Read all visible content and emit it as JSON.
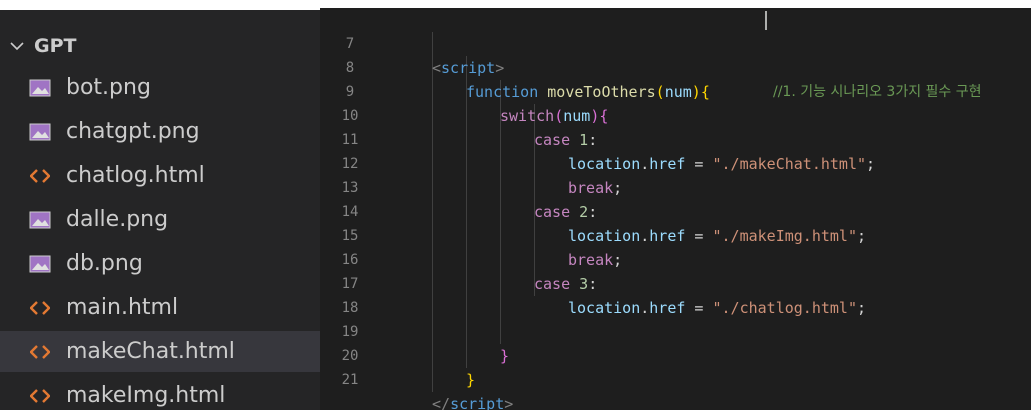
{
  "explorer": {
    "folder_name": "GPT",
    "files": [
      {
        "name": "bot.png",
        "type": "image"
      },
      {
        "name": "chatgpt.png",
        "type": "image"
      },
      {
        "name": "chatlog.html",
        "type": "html"
      },
      {
        "name": "dalle.png",
        "type": "image"
      },
      {
        "name": "db.png",
        "type": "image"
      },
      {
        "name": "main.html",
        "type": "html"
      },
      {
        "name": "makeChat.html",
        "type": "html",
        "selected": true
      },
      {
        "name": "makeImg.html",
        "type": "html"
      }
    ]
  },
  "editor": {
    "lines": [
      {
        "num": "7",
        "tag_open": "<",
        "tag_name": "script",
        "tag_close": ">",
        "comment": "//1. 기능 시나리오 3가지 필수 구현"
      },
      {
        "num": "8",
        "kw": "function",
        "fn": "moveToOthers",
        "p1": "(",
        "param": "num",
        "p2": ")",
        "brace": "{"
      },
      {
        "num": "9",
        "kw": "switch",
        "p1": "(",
        "param": "num",
        "p2": ")",
        "brace": "{"
      },
      {
        "num": "10",
        "kw": "case",
        "val": "1",
        "colon": ":"
      },
      {
        "num": "11",
        "obj": "location",
        "dot": ".",
        "prop": "href",
        "eq": " = ",
        "str": "\"./makeChat.html\"",
        "semi": ";"
      },
      {
        "num": "12",
        "kw": "break",
        "semi": ";"
      },
      {
        "num": "13",
        "kw": "case",
        "val": "2",
        "colon": ":"
      },
      {
        "num": "14",
        "obj": "location",
        "dot": ".",
        "prop": "href",
        "eq": " = ",
        "str": "\"./makeImg.html\"",
        "semi": ";"
      },
      {
        "num": "15",
        "kw": "break",
        "semi": ";"
      },
      {
        "num": "16",
        "kw": "case",
        "val": "3",
        "colon": ":"
      },
      {
        "num": "17",
        "obj": "location",
        "dot": ".",
        "prop": "href",
        "eq": " = ",
        "str": "\"./chatlog.html\"",
        "semi": ";"
      },
      {
        "num": "18"
      },
      {
        "num": "19",
        "brace": "}"
      },
      {
        "num": "20",
        "brace": "}"
      },
      {
        "num": "21",
        "tag_open": "</",
        "tag_name": "script",
        "tag_close": ">"
      }
    ]
  }
}
